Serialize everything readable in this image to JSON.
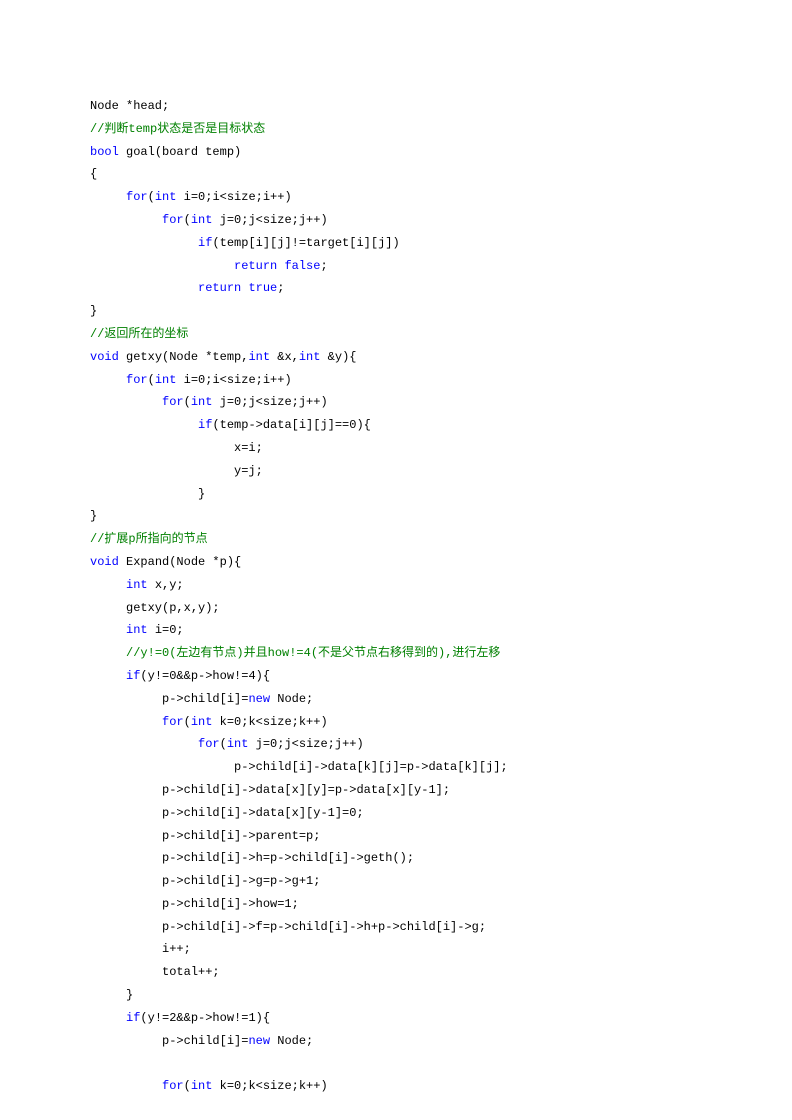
{
  "lines": [
    [
      {
        "t": "Node *head;",
        "c": "plain"
      }
    ],
    [
      {
        "t": "//判断temp状态是否是目标状态",
        "c": "comment"
      }
    ],
    [
      {
        "t": "bool",
        "c": "kw"
      },
      {
        "t": " goal(board temp)",
        "c": "plain"
      }
    ],
    [
      {
        "t": "{",
        "c": "plain"
      }
    ],
    [
      {
        "t": "     ",
        "c": "plain"
      },
      {
        "t": "for",
        "c": "kw"
      },
      {
        "t": "(",
        "c": "plain"
      },
      {
        "t": "int",
        "c": "kw"
      },
      {
        "t": " i=0;i<size;i++)",
        "c": "plain"
      }
    ],
    [
      {
        "t": "          ",
        "c": "plain"
      },
      {
        "t": "for",
        "c": "kw"
      },
      {
        "t": "(",
        "c": "plain"
      },
      {
        "t": "int",
        "c": "kw"
      },
      {
        "t": " j=0;j<size;j++)",
        "c": "plain"
      }
    ],
    [
      {
        "t": "               ",
        "c": "plain"
      },
      {
        "t": "if",
        "c": "kw"
      },
      {
        "t": "(temp[i][j]!=target[i][j])",
        "c": "plain"
      }
    ],
    [
      {
        "t": "                    ",
        "c": "plain"
      },
      {
        "t": "return",
        "c": "kw"
      },
      {
        "t": " ",
        "c": "plain"
      },
      {
        "t": "false",
        "c": "kw"
      },
      {
        "t": ";",
        "c": "plain"
      }
    ],
    [
      {
        "t": "               ",
        "c": "plain"
      },
      {
        "t": "return",
        "c": "kw"
      },
      {
        "t": " ",
        "c": "plain"
      },
      {
        "t": "true",
        "c": "kw"
      },
      {
        "t": ";",
        "c": "plain"
      }
    ],
    [
      {
        "t": "}",
        "c": "plain"
      }
    ],
    [
      {
        "t": "//返回所在的坐标",
        "c": "comment"
      }
    ],
    [
      {
        "t": "void",
        "c": "kw"
      },
      {
        "t": " getxy(Node *temp,",
        "c": "plain"
      },
      {
        "t": "int",
        "c": "kw"
      },
      {
        "t": " &x,",
        "c": "plain"
      },
      {
        "t": "int",
        "c": "kw"
      },
      {
        "t": " &y){",
        "c": "plain"
      }
    ],
    [
      {
        "t": "     ",
        "c": "plain"
      },
      {
        "t": "for",
        "c": "kw"
      },
      {
        "t": "(",
        "c": "plain"
      },
      {
        "t": "int",
        "c": "kw"
      },
      {
        "t": " i=0;i<size;i++)",
        "c": "plain"
      }
    ],
    [
      {
        "t": "          ",
        "c": "plain"
      },
      {
        "t": "for",
        "c": "kw"
      },
      {
        "t": "(",
        "c": "plain"
      },
      {
        "t": "int",
        "c": "kw"
      },
      {
        "t": " j=0;j<size;j++)",
        "c": "plain"
      }
    ],
    [
      {
        "t": "               ",
        "c": "plain"
      },
      {
        "t": "if",
        "c": "kw"
      },
      {
        "t": "(temp->data[i][j]==0){",
        "c": "plain"
      }
    ],
    [
      {
        "t": "                    x=i;",
        "c": "plain"
      }
    ],
    [
      {
        "t": "                    y=j;",
        "c": "plain"
      }
    ],
    [
      {
        "t": "               }",
        "c": "plain"
      }
    ],
    [
      {
        "t": "}",
        "c": "plain"
      }
    ],
    [
      {
        "t": "//扩展p所指向的节点",
        "c": "comment"
      }
    ],
    [
      {
        "t": "void",
        "c": "kw"
      },
      {
        "t": " Expand(Node *p){",
        "c": "plain"
      }
    ],
    [
      {
        "t": "     ",
        "c": "plain"
      },
      {
        "t": "int",
        "c": "kw"
      },
      {
        "t": " x,y;",
        "c": "plain"
      }
    ],
    [
      {
        "t": "     getxy(p,x,y);",
        "c": "plain"
      }
    ],
    [
      {
        "t": "     ",
        "c": "plain"
      },
      {
        "t": "int",
        "c": "kw"
      },
      {
        "t": " i=0;",
        "c": "plain"
      }
    ],
    [
      {
        "t": "     ",
        "c": "plain"
      },
      {
        "t": "//y!=0(左边有节点)并且how!=4(不是父节点右移得到的),进行左移",
        "c": "comment"
      }
    ],
    [
      {
        "t": "     ",
        "c": "plain"
      },
      {
        "t": "if",
        "c": "kw"
      },
      {
        "t": "(y!=0&&p->how!=4){",
        "c": "plain"
      }
    ],
    [
      {
        "t": "          p->child[i]=",
        "c": "plain"
      },
      {
        "t": "new",
        "c": "kw"
      },
      {
        "t": " Node;",
        "c": "plain"
      }
    ],
    [
      {
        "t": "          ",
        "c": "plain"
      },
      {
        "t": "for",
        "c": "kw"
      },
      {
        "t": "(",
        "c": "plain"
      },
      {
        "t": "int",
        "c": "kw"
      },
      {
        "t": " k=0;k<size;k++)",
        "c": "plain"
      }
    ],
    [
      {
        "t": "               ",
        "c": "plain"
      },
      {
        "t": "for",
        "c": "kw"
      },
      {
        "t": "(",
        "c": "plain"
      },
      {
        "t": "int",
        "c": "kw"
      },
      {
        "t": " j=0;j<size;j++)",
        "c": "plain"
      }
    ],
    [
      {
        "t": "                    p->child[i]->data[k][j]=p->data[k][j];",
        "c": "plain"
      }
    ],
    [
      {
        "t": "          p->child[i]->data[x][y]=p->data[x][y-1];",
        "c": "plain"
      }
    ],
    [
      {
        "t": "          p->child[i]->data[x][y-1]=0;",
        "c": "plain"
      }
    ],
    [
      {
        "t": "          p->child[i]->parent=p;",
        "c": "plain"
      }
    ],
    [
      {
        "t": "          p->child[i]->h=p->child[i]->geth();",
        "c": "plain"
      }
    ],
    [
      {
        "t": "          p->child[i]->g=p->g+1;",
        "c": "plain"
      }
    ],
    [
      {
        "t": "          p->child[i]->how=1;",
        "c": "plain"
      }
    ],
    [
      {
        "t": "          p->child[i]->f=p->child[i]->h+p->child[i]->g;",
        "c": "plain"
      }
    ],
    [
      {
        "t": "          i++;",
        "c": "plain"
      }
    ],
    [
      {
        "t": "          total++;",
        "c": "plain"
      }
    ],
    [
      {
        "t": "     }",
        "c": "plain"
      }
    ],
    [
      {
        "t": "     ",
        "c": "plain"
      },
      {
        "t": "if",
        "c": "kw"
      },
      {
        "t": "(y!=2&&p->how!=1){",
        "c": "plain"
      }
    ],
    [
      {
        "t": "          p->child[i]=",
        "c": "plain"
      },
      {
        "t": "new",
        "c": "kw"
      },
      {
        "t": " Node;",
        "c": "plain"
      }
    ],
    [
      {
        "t": "",
        "c": "plain"
      }
    ],
    [
      {
        "t": "          ",
        "c": "plain"
      },
      {
        "t": "for",
        "c": "kw"
      },
      {
        "t": "(",
        "c": "plain"
      },
      {
        "t": "int",
        "c": "kw"
      },
      {
        "t": " k=0;k<size;k++)",
        "c": "plain"
      }
    ]
  ]
}
